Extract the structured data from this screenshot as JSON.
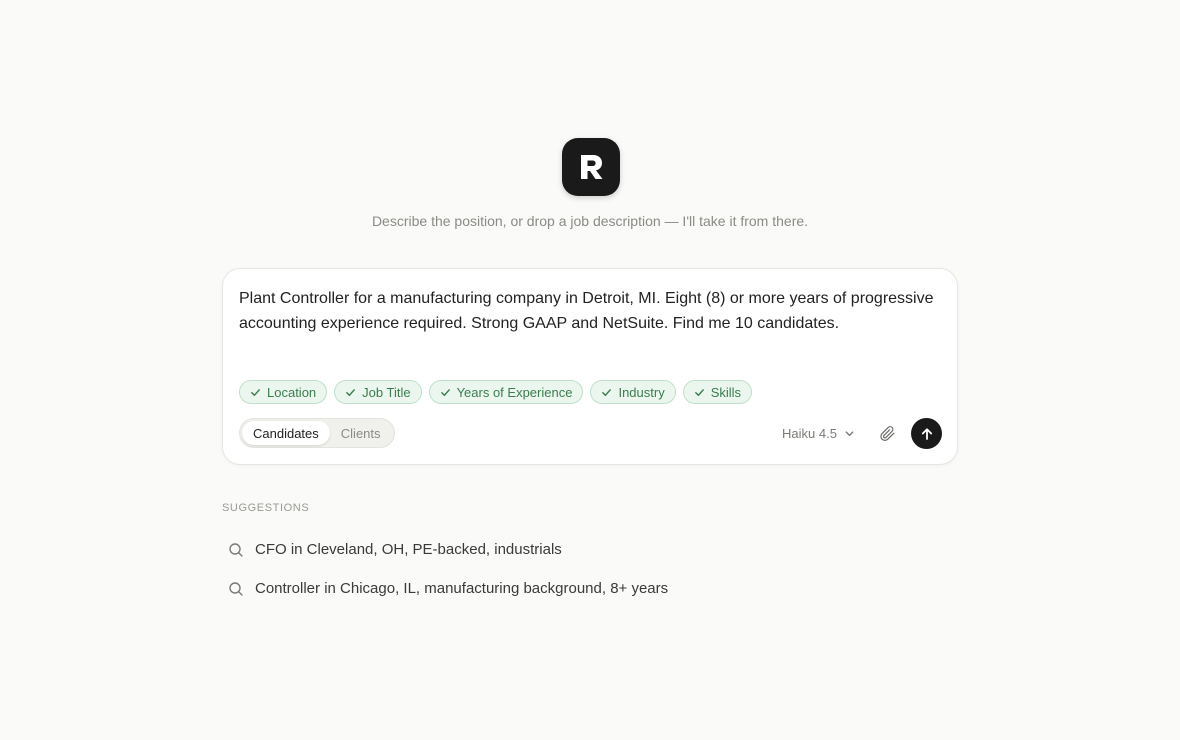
{
  "logo": {
    "letter": "R",
    "icon": "brand-r-logo"
  },
  "tagline": "Describe the position, or drop a job description — I'll take it from there.",
  "composer": {
    "prompt_text": "Plant Controller for a manufacturing company in Detroit, MI. Eight (8) or more years of progressive accounting experience required. Strong GAAP and NetSuite. Find me 10 candidates.",
    "chips": [
      {
        "label": "Location",
        "icon": "check-icon"
      },
      {
        "label": "Job Title",
        "icon": "check-icon"
      },
      {
        "label": "Years of Experience",
        "icon": "check-icon"
      },
      {
        "label": "Industry",
        "icon": "check-icon"
      },
      {
        "label": "Skills",
        "icon": "check-icon"
      }
    ],
    "mode_toggle": {
      "options": [
        "Candidates",
        "Clients"
      ],
      "selected": "Candidates"
    },
    "model": {
      "label": "Haiku 4.5",
      "icon": "chevron-down-icon"
    },
    "attach_icon": "paperclip-icon",
    "send_icon": "arrow-up-icon"
  },
  "suggestions": {
    "header": "SUGGESTIONS",
    "items": [
      {
        "text": "CFO in Cleveland, OH, PE-backed, industrials",
        "icon": "search-icon"
      },
      {
        "text": "Controller in Chicago, IL, manufacturing background, 8+ years",
        "icon": "search-icon"
      }
    ]
  },
  "colors": {
    "background": "#fafaf8",
    "chip_bg": "#eaf6ee",
    "chip_border": "#bfe0c9",
    "chip_text": "#3b7d4f",
    "dark": "#1a1a1a"
  }
}
